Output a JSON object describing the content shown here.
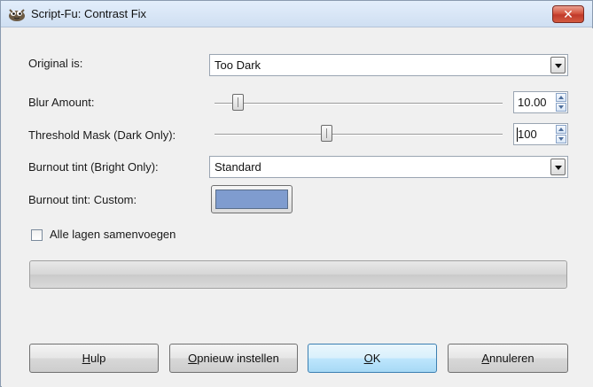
{
  "window": {
    "title": "Script-Fu: Contrast Fix",
    "close_label": "✕"
  },
  "fields": {
    "original": {
      "label": "Original is:",
      "value": "Too Dark"
    },
    "blur": {
      "label": "Blur Amount:",
      "value": "10.00",
      "level": 0.08
    },
    "threshold": {
      "label": "Threshold Mask (Dark Only):",
      "value": "100",
      "level": 0.39
    },
    "burnout_tint": {
      "label": "Burnout tint (Bright Only):",
      "value": "Standard"
    },
    "burnout_custom": {
      "label": "Burnout tint: Custom:",
      "color": "#7f9ccf"
    },
    "flatten": {
      "label": "Alle lagen samenvoegen",
      "checked": false
    }
  },
  "progress": {
    "fraction": 0
  },
  "buttons": {
    "help": {
      "mnemonic": "H",
      "rest": "ulp"
    },
    "reset": {
      "mnemonic": "O",
      "rest": "pnieuw instellen"
    },
    "ok": {
      "mnemonic": "O",
      "rest": "K"
    },
    "cancel": {
      "mnemonic": "A",
      "rest": "nnuleren"
    }
  },
  "colors": {
    "close_button": "#c0392b",
    "default_button": "#3c7fb1",
    "custom_swatch": "#7f9ccf"
  }
}
